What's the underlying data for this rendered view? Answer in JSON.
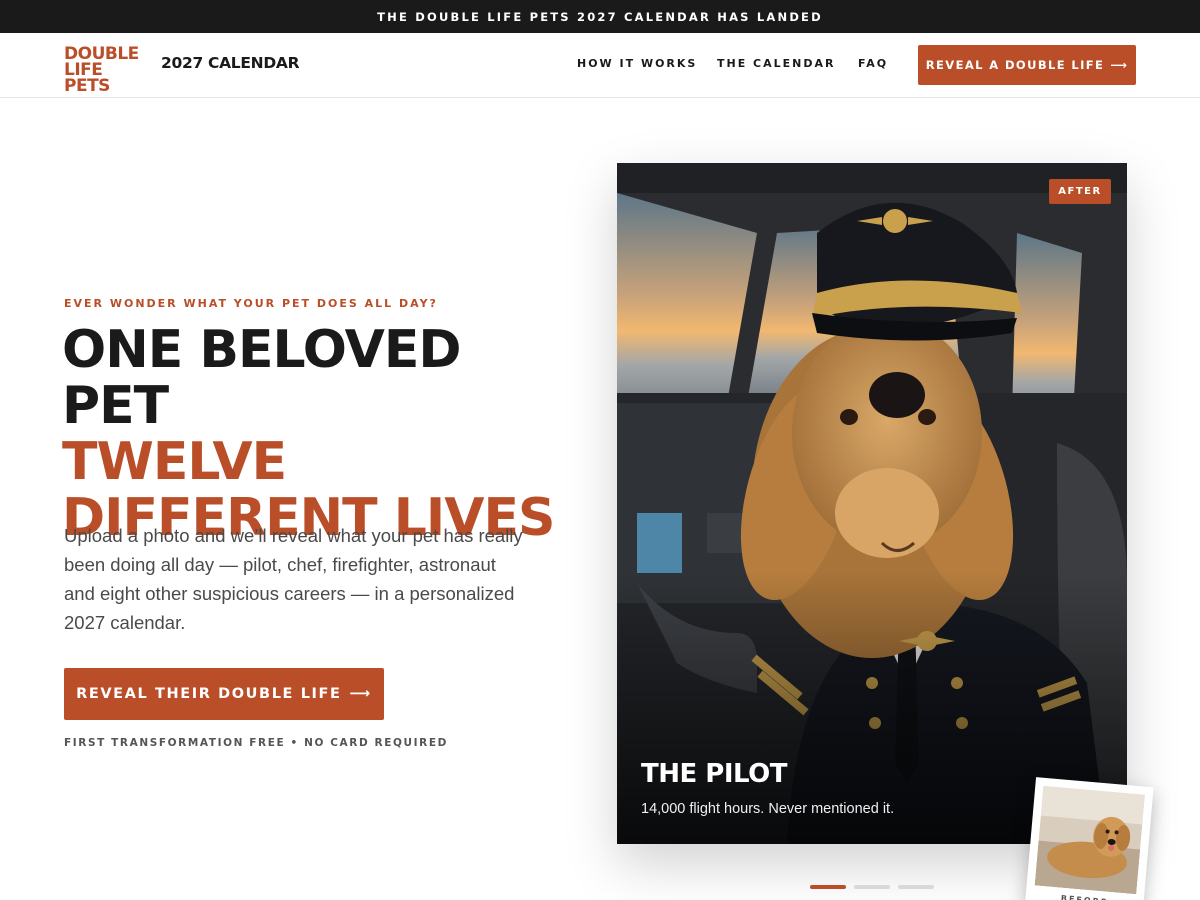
{
  "announcement": "THE DOUBLE LIFE PETS 2027 CALENDAR HAS LANDED",
  "header": {
    "logo_line1": "DOUBLE",
    "logo_line2": "LIFE PETS",
    "brand_subtitle": "2027 CALENDAR",
    "nav": [
      "HOW IT WORKS",
      "THE CALENDAR",
      "FAQ"
    ],
    "cta_label": "REVEAL A DOUBLE LIFE",
    "cta_arrow": "⟶"
  },
  "hero": {
    "eyebrow": "EVER WONDER WHAT YOUR PET DOES ALL DAY?",
    "headline_line1": "ONE BELOVED PET",
    "headline_line2": "TWELVE",
    "headline_line3": "DIFFERENT LIVES",
    "body": "Upload a photo and we’ll reveal what your pet has really been doing all day — pilot, chef, firefighter, astronaut and eight other suspicious careers — in a personalized 2027 calendar.",
    "cta_label": "REVEAL THEIR DOUBLE LIFE",
    "cta_arrow": "⟶",
    "fine_print": "FIRST TRANSFORMATION FREE • NO CARD REQUIRED"
  },
  "showcase": {
    "after_badge": "AFTER",
    "title": "THE PILOT",
    "caption": "14,000 flight hours. Never mentioned it.",
    "before_label": "BEFORE",
    "slides_total": 3,
    "active_slide": 1
  },
  "colors": {
    "accent": "#b94e28",
    "dark": "#1a1a1a",
    "muted_text": "#4a4a4a"
  }
}
